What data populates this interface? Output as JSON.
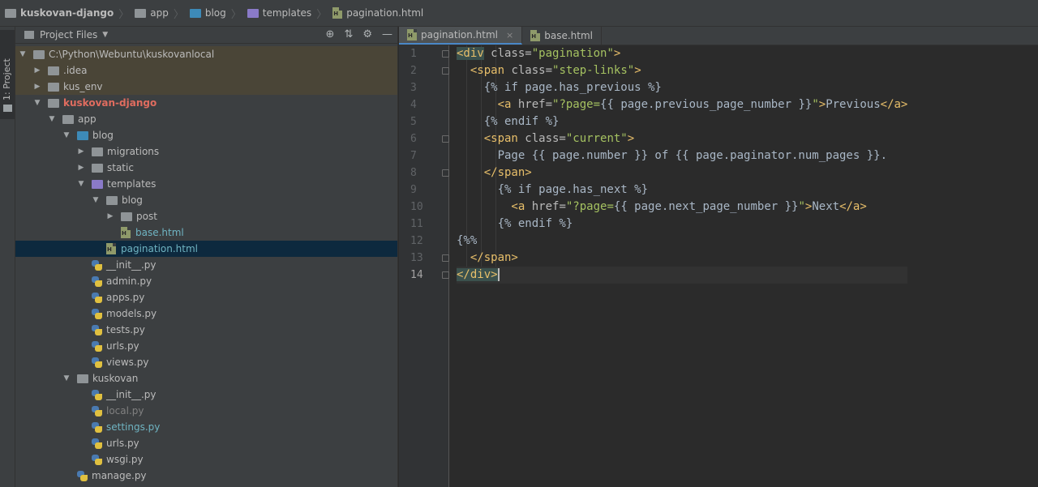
{
  "breadcrumb": [
    {
      "label": "kuskovan-django",
      "icon": "folder-icon",
      "bold": true
    },
    {
      "label": "app",
      "icon": "folder-icon"
    },
    {
      "label": "blog",
      "icon": "folder-blue-icon"
    },
    {
      "label": "templates",
      "icon": "folder-purple-icon"
    },
    {
      "label": "pagination.html",
      "icon": "html-file-icon"
    }
  ],
  "sidebar": {
    "tool_window_label": "1: Project",
    "panel_title": "Project Files"
  },
  "tree": [
    {
      "label": "C:\\Python\\Webuntu\\kuskovanlocal",
      "depth": 0,
      "arrow": "▼",
      "kind": "folder",
      "style": "normal",
      "rowbg": "dir"
    },
    {
      "label": ".idea",
      "depth": 1,
      "arrow": "▶",
      "kind": "folder",
      "style": "normal",
      "rowbg": "dir"
    },
    {
      "label": "kus_env",
      "depth": 1,
      "arrow": "▶",
      "kind": "folder",
      "style": "normal",
      "rowbg": "dir"
    },
    {
      "label": "kuskovan-django",
      "depth": 1,
      "arrow": "▼",
      "kind": "folder",
      "style": "red",
      "rowbg": ""
    },
    {
      "label": "app",
      "depth": 2,
      "arrow": "▼",
      "kind": "folder",
      "style": "normal",
      "rowbg": ""
    },
    {
      "label": "blog",
      "depth": 3,
      "arrow": "▼",
      "kind": "folder-blue",
      "style": "normal",
      "rowbg": ""
    },
    {
      "label": "migrations",
      "depth": 4,
      "arrow": "▶",
      "kind": "folder",
      "style": "normal",
      "rowbg": ""
    },
    {
      "label": "static",
      "depth": 4,
      "arrow": "▶",
      "kind": "folder",
      "style": "normal",
      "rowbg": ""
    },
    {
      "label": "templates",
      "depth": 4,
      "arrow": "▼",
      "kind": "folder-purple",
      "style": "normal",
      "rowbg": ""
    },
    {
      "label": "blog",
      "depth": 5,
      "arrow": "▼",
      "kind": "folder",
      "style": "normal",
      "rowbg": ""
    },
    {
      "label": "post",
      "depth": 6,
      "arrow": "▶",
      "kind": "folder",
      "style": "normal",
      "rowbg": ""
    },
    {
      "label": "base.html",
      "depth": 6,
      "arrow": "",
      "kind": "html",
      "style": "teal",
      "rowbg": ""
    },
    {
      "label": "pagination.html",
      "depth": 5,
      "arrow": "",
      "kind": "html",
      "style": "teal",
      "rowbg": "sel"
    },
    {
      "label": "__init__.py",
      "depth": 4,
      "arrow": "",
      "kind": "py",
      "style": "normal",
      "rowbg": ""
    },
    {
      "label": "admin.py",
      "depth": 4,
      "arrow": "",
      "kind": "py",
      "style": "normal",
      "rowbg": ""
    },
    {
      "label": "apps.py",
      "depth": 4,
      "arrow": "",
      "kind": "py",
      "style": "normal",
      "rowbg": ""
    },
    {
      "label": "models.py",
      "depth": 4,
      "arrow": "",
      "kind": "py",
      "style": "normal",
      "rowbg": ""
    },
    {
      "label": "tests.py",
      "depth": 4,
      "arrow": "",
      "kind": "py",
      "style": "normal",
      "rowbg": ""
    },
    {
      "label": "urls.py",
      "depth": 4,
      "arrow": "",
      "kind": "py",
      "style": "normal",
      "rowbg": ""
    },
    {
      "label": "views.py",
      "depth": 4,
      "arrow": "",
      "kind": "py",
      "style": "normal",
      "rowbg": ""
    },
    {
      "label": "kuskovan",
      "depth": 3,
      "arrow": "▼",
      "kind": "folder",
      "style": "normal",
      "rowbg": ""
    },
    {
      "label": "__init__.py",
      "depth": 4,
      "arrow": "",
      "kind": "py",
      "style": "normal",
      "rowbg": ""
    },
    {
      "label": "local.py",
      "depth": 4,
      "arrow": "",
      "kind": "py",
      "style": "grey",
      "rowbg": ""
    },
    {
      "label": "settings.py",
      "depth": 4,
      "arrow": "",
      "kind": "py",
      "style": "green",
      "rowbg": ""
    },
    {
      "label": "urls.py",
      "depth": 4,
      "arrow": "",
      "kind": "py",
      "style": "normal",
      "rowbg": ""
    },
    {
      "label": "wsgi.py",
      "depth": 4,
      "arrow": "",
      "kind": "py",
      "style": "normal",
      "rowbg": ""
    },
    {
      "label": "manage.py",
      "depth": 3,
      "arrow": "",
      "kind": "py",
      "style": "normal",
      "rowbg": ""
    }
  ],
  "tabs": [
    {
      "label": "pagination.html",
      "active": true
    },
    {
      "label": "base.html",
      "active": false
    }
  ],
  "line_numbers": [
    "1",
    "2",
    "3",
    "4",
    "5",
    "6",
    "7",
    "8",
    "9",
    "10",
    "11",
    "12",
    "13",
    "14"
  ],
  "code": [
    [
      {
        "t": "<div",
        "c": "tag tagbg"
      },
      {
        "t": " class=",
        "c": "attr"
      },
      {
        "t": "\"pagination\"",
        "c": "val"
      },
      {
        "t": ">",
        "c": "tag"
      }
    ],
    [
      {
        "t": "  <span",
        "c": "tag"
      },
      {
        "t": " class=",
        "c": "attr"
      },
      {
        "t": "\"step-links\"",
        "c": "val"
      },
      {
        "t": ">",
        "c": "tag"
      }
    ],
    [
      {
        "t": "    {% if page.has_previous %}",
        "c": "tmpl"
      }
    ],
    [
      {
        "t": "      <a",
        "c": "tag"
      },
      {
        "t": " href=",
        "c": "attr"
      },
      {
        "t": "\"?page=",
        "c": "val"
      },
      {
        "t": "{{ page.previous_page_number }}",
        "c": "tmpl"
      },
      {
        "t": "\"",
        "c": "val"
      },
      {
        "t": ">",
        "c": "tag"
      },
      {
        "t": "Previous",
        "c": "tmpl"
      },
      {
        "t": "</a>",
        "c": "tag"
      }
    ],
    [
      {
        "t": "    {% endif %}",
        "c": "tmpl"
      }
    ],
    [
      {
        "t": "    <span",
        "c": "tag"
      },
      {
        "t": " class=",
        "c": "attr"
      },
      {
        "t": "\"current\"",
        "c": "val"
      },
      {
        "t": ">",
        "c": "tag"
      }
    ],
    [
      {
        "t": "      Page {{ page.number }} of {{ page.paginator.num_pages }}.",
        "c": "tmpl"
      }
    ],
    [
      {
        "t": "    </span>",
        "c": "tag"
      }
    ],
    [
      {
        "t": "      {% if page.has_next %}",
        "c": "tmpl"
      }
    ],
    [
      {
        "t": "        <a",
        "c": "tag"
      },
      {
        "t": " href=",
        "c": "attr"
      },
      {
        "t": "\"?page=",
        "c": "val"
      },
      {
        "t": "{{ page.next_page_number }}",
        "c": "tmpl"
      },
      {
        "t": "\"",
        "c": "val"
      },
      {
        "t": ">",
        "c": "tag"
      },
      {
        "t": "Next",
        "c": "tmpl"
      },
      {
        "t": "</a>",
        "c": "tag"
      }
    ],
    [
      {
        "t": "      {% endif %}",
        "c": "tmpl"
      }
    ],
    [
      {
        "t": "{%%",
        "c": "tmpl"
      }
    ],
    [
      {
        "t": "  </span>",
        "c": "tag"
      }
    ],
    [
      {
        "t": "</div>",
        "c": "tag tagbg"
      }
    ]
  ],
  "current_line": 14
}
